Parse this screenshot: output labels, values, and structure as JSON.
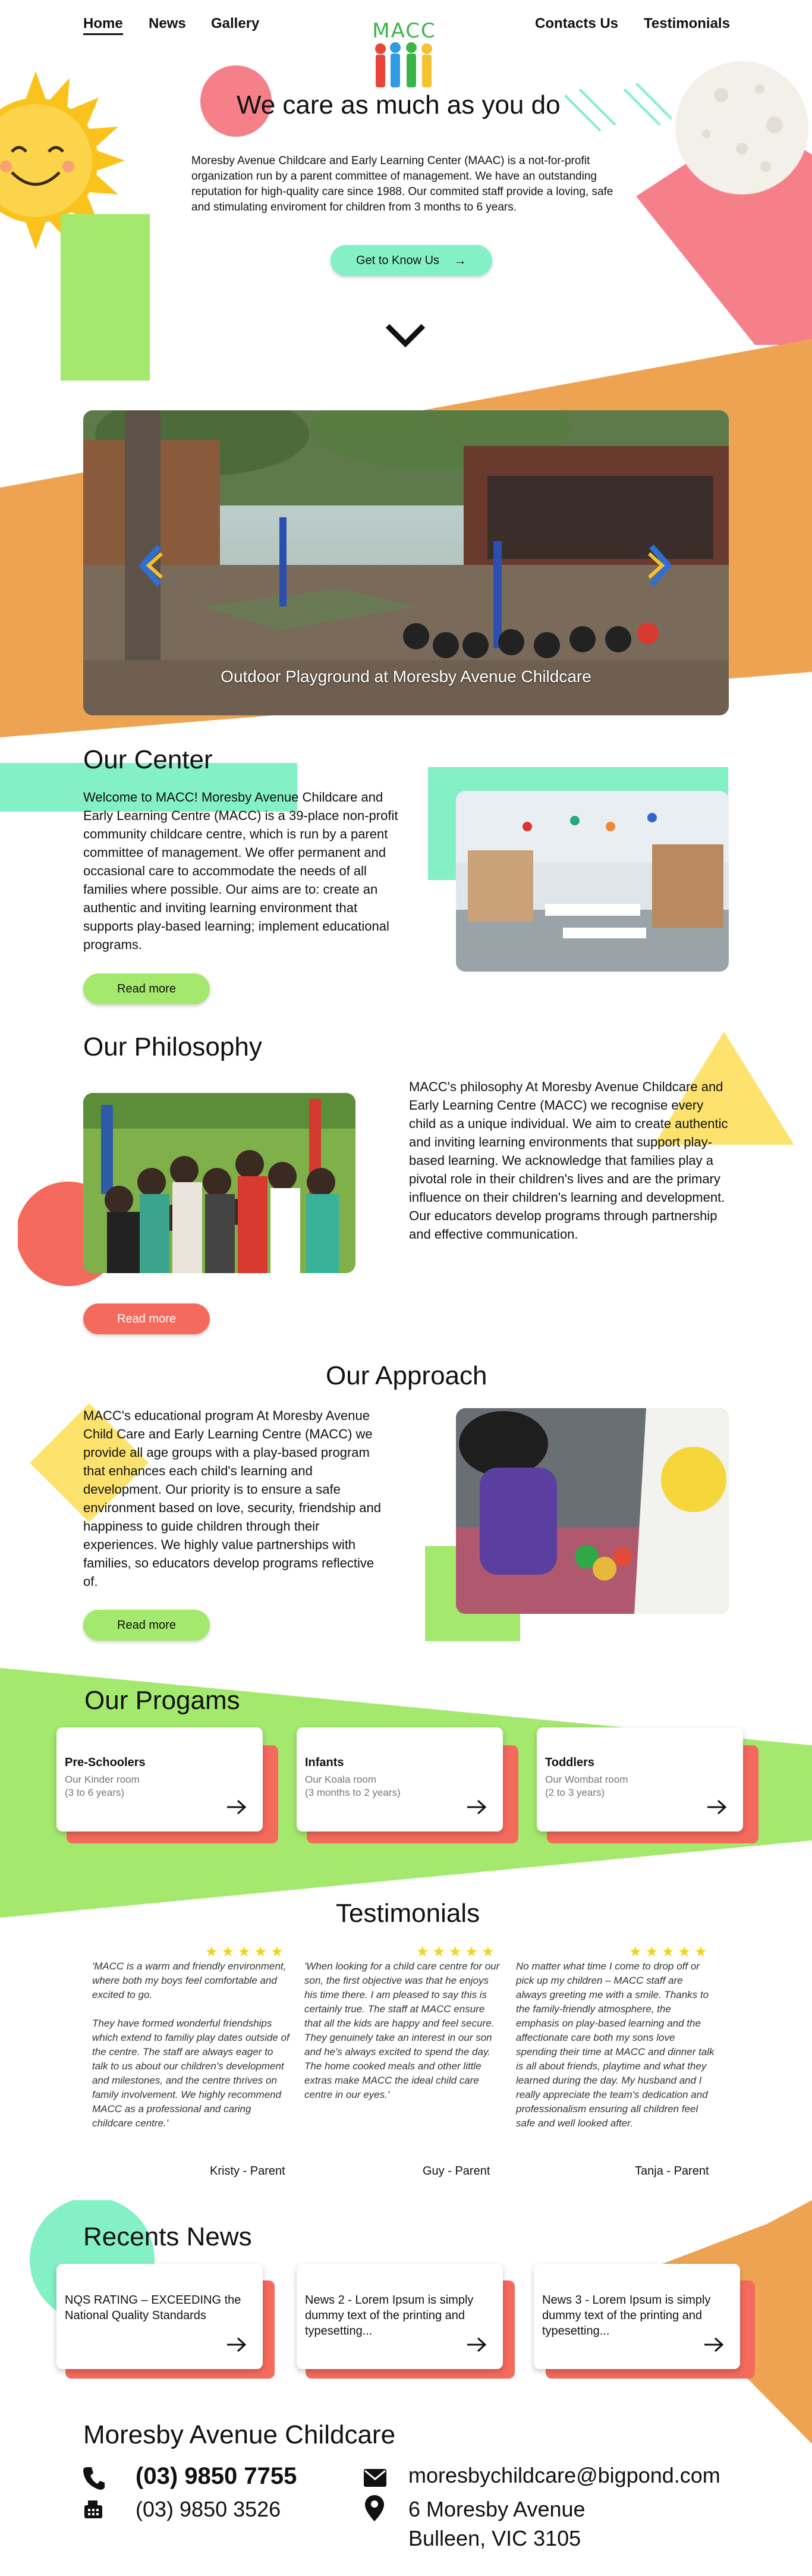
{
  "nav": {
    "home": "Home",
    "news": "News",
    "gallery": "Gallery",
    "contacts": "Contacts Us",
    "testimonials": "Testimonials",
    "logo_text": "MACC"
  },
  "hero": {
    "title": "We care as much as you do",
    "text": "Moresby Avenue Childcare and Early Learning Center (MAAC) is a not-for-profit organization run by a parent committee of management. We have an outstanding reputation for high-quality care since 1988. Our commited staff provide a loving, safe and stimulating enviroment for children from 3 months to 6 years.",
    "button": "Get to Know Us"
  },
  "slider": {
    "caption": "Outdoor Playground at Moresby Avenue Childcare"
  },
  "center": {
    "title": "Our Center",
    "text": "Welcome to MACC! Moresby Avenue Childcare and Early Learning Centre (MACC) is a 39-place non-profit community childcare centre, which is run by a parent committee of management. We offer permanent and occasional care to accommodate the needs of all families where possible. Our aims are to: create an authentic and inviting learning environment that supports play-based learning; implement educational programs.",
    "button": "Read more"
  },
  "philosophy": {
    "title": "Our Philosophy",
    "text": "MACC's philosophy At Moresby Avenue Childcare and Early Learning Centre (MACC) we recognise every child as a unique individual. We aim to create authentic and inviting learning environments that support play-based learning. We acknowledge that families play a pivotal role in their children's lives and are the primary influence on their children's learning and development. Our educators develop programs through partnership and effective communication.",
    "button": "Read more"
  },
  "approach": {
    "title": "Our Approach",
    "text": " MACC's educational program  At Moresby Avenue Child Care and Early Learning Centre (MACC) we provide all age groups with a play-based program that enhances each child's learning and development. Our priority is to ensure a safe environment based on love, security, friendship and happiness to guide children through their experiences. We highly value partnerships with families, so educators develop programs reflective of.",
    "button": "Read more"
  },
  "programs": {
    "title": "Our Progams",
    "items": [
      {
        "title": "Pre-Schoolers",
        "room": "Our Kinder room",
        "ages": "(3 to 6 years)"
      },
      {
        "title": "Infants",
        "room": "Our Koala room",
        "ages": "(3 months to 2 years)"
      },
      {
        "title": "Toddlers",
        "room": "Our Wombat room",
        "ages": "(2 to 3 years)"
      }
    ]
  },
  "testimonials": {
    "title": "Testimonials",
    "stars": "★★★★★",
    "items": [
      {
        "text": "'MACC is a warm and friendly environment, where both my boys feel comfortable and excited to go.\n\nThey have formed wonderful friendships which extend to familiy play dates outside of the centre. The staff are always eager to talk to us about our children's development and milestones, and the centre thrives on family involvement. We highly recommend MACC as a professional and caring childcare centre.'",
        "author": "Kristy - Parent"
      },
      {
        "text": "'When looking for a child care centre for our son, the first objective was that he enjoys his time there. I am pleased to say this is certainly true. The staff at MACC ensure that all the kids are happy and feel secure. They genuinely take an interest in our son and he's always excited to spend the day. The home cooked meals and other little extras make MACC the ideal child care centre in our eyes.'",
        "author": "Guy - Parent"
      },
      {
        "text": "No matter what time I come to drop off or pick up my children – MACC staff are always greeting me with a smile. Thanks to the family-friendly atmosphere, the emphasis on play-based learning and the affectionate care both my sons love spending their time at MACC and dinner talk is all about friends, playtime and what they learned during the day. My husband and I really appreciate the team's dedication and professionalism ensuring all children feel safe and well looked after.",
        "author": "Tanja - Parent"
      }
    ]
  },
  "news": {
    "title": "Recents News",
    "items": [
      {
        "text": "NQS RATING – EXCEEDING the National Quality Standards"
      },
      {
        "text": "News 2 - Lorem Ipsum is simply dummy text of the printing and typesetting..."
      },
      {
        "text": "News 3  - Lorem Ipsum is simply dummy text of the printing and typesetting..."
      }
    ]
  },
  "footer": {
    "title": "Moresby Avenue Childcare",
    "phone": "(03) 9850 7755",
    "fax": "(03) 9850 3526",
    "email": "moresbychildcare@bigpond.com",
    "address_line1": "6 Moresby Avenue",
    "address_line2": "Bulleen, VIC 3105"
  },
  "colors": {
    "orange": "#eea353",
    "mint": "#84f0c6",
    "green": "#a4e86d",
    "coral": "#f46a5c",
    "pink": "#f6808a",
    "yellow": "#fde36e",
    "star": "#f7d21a"
  }
}
